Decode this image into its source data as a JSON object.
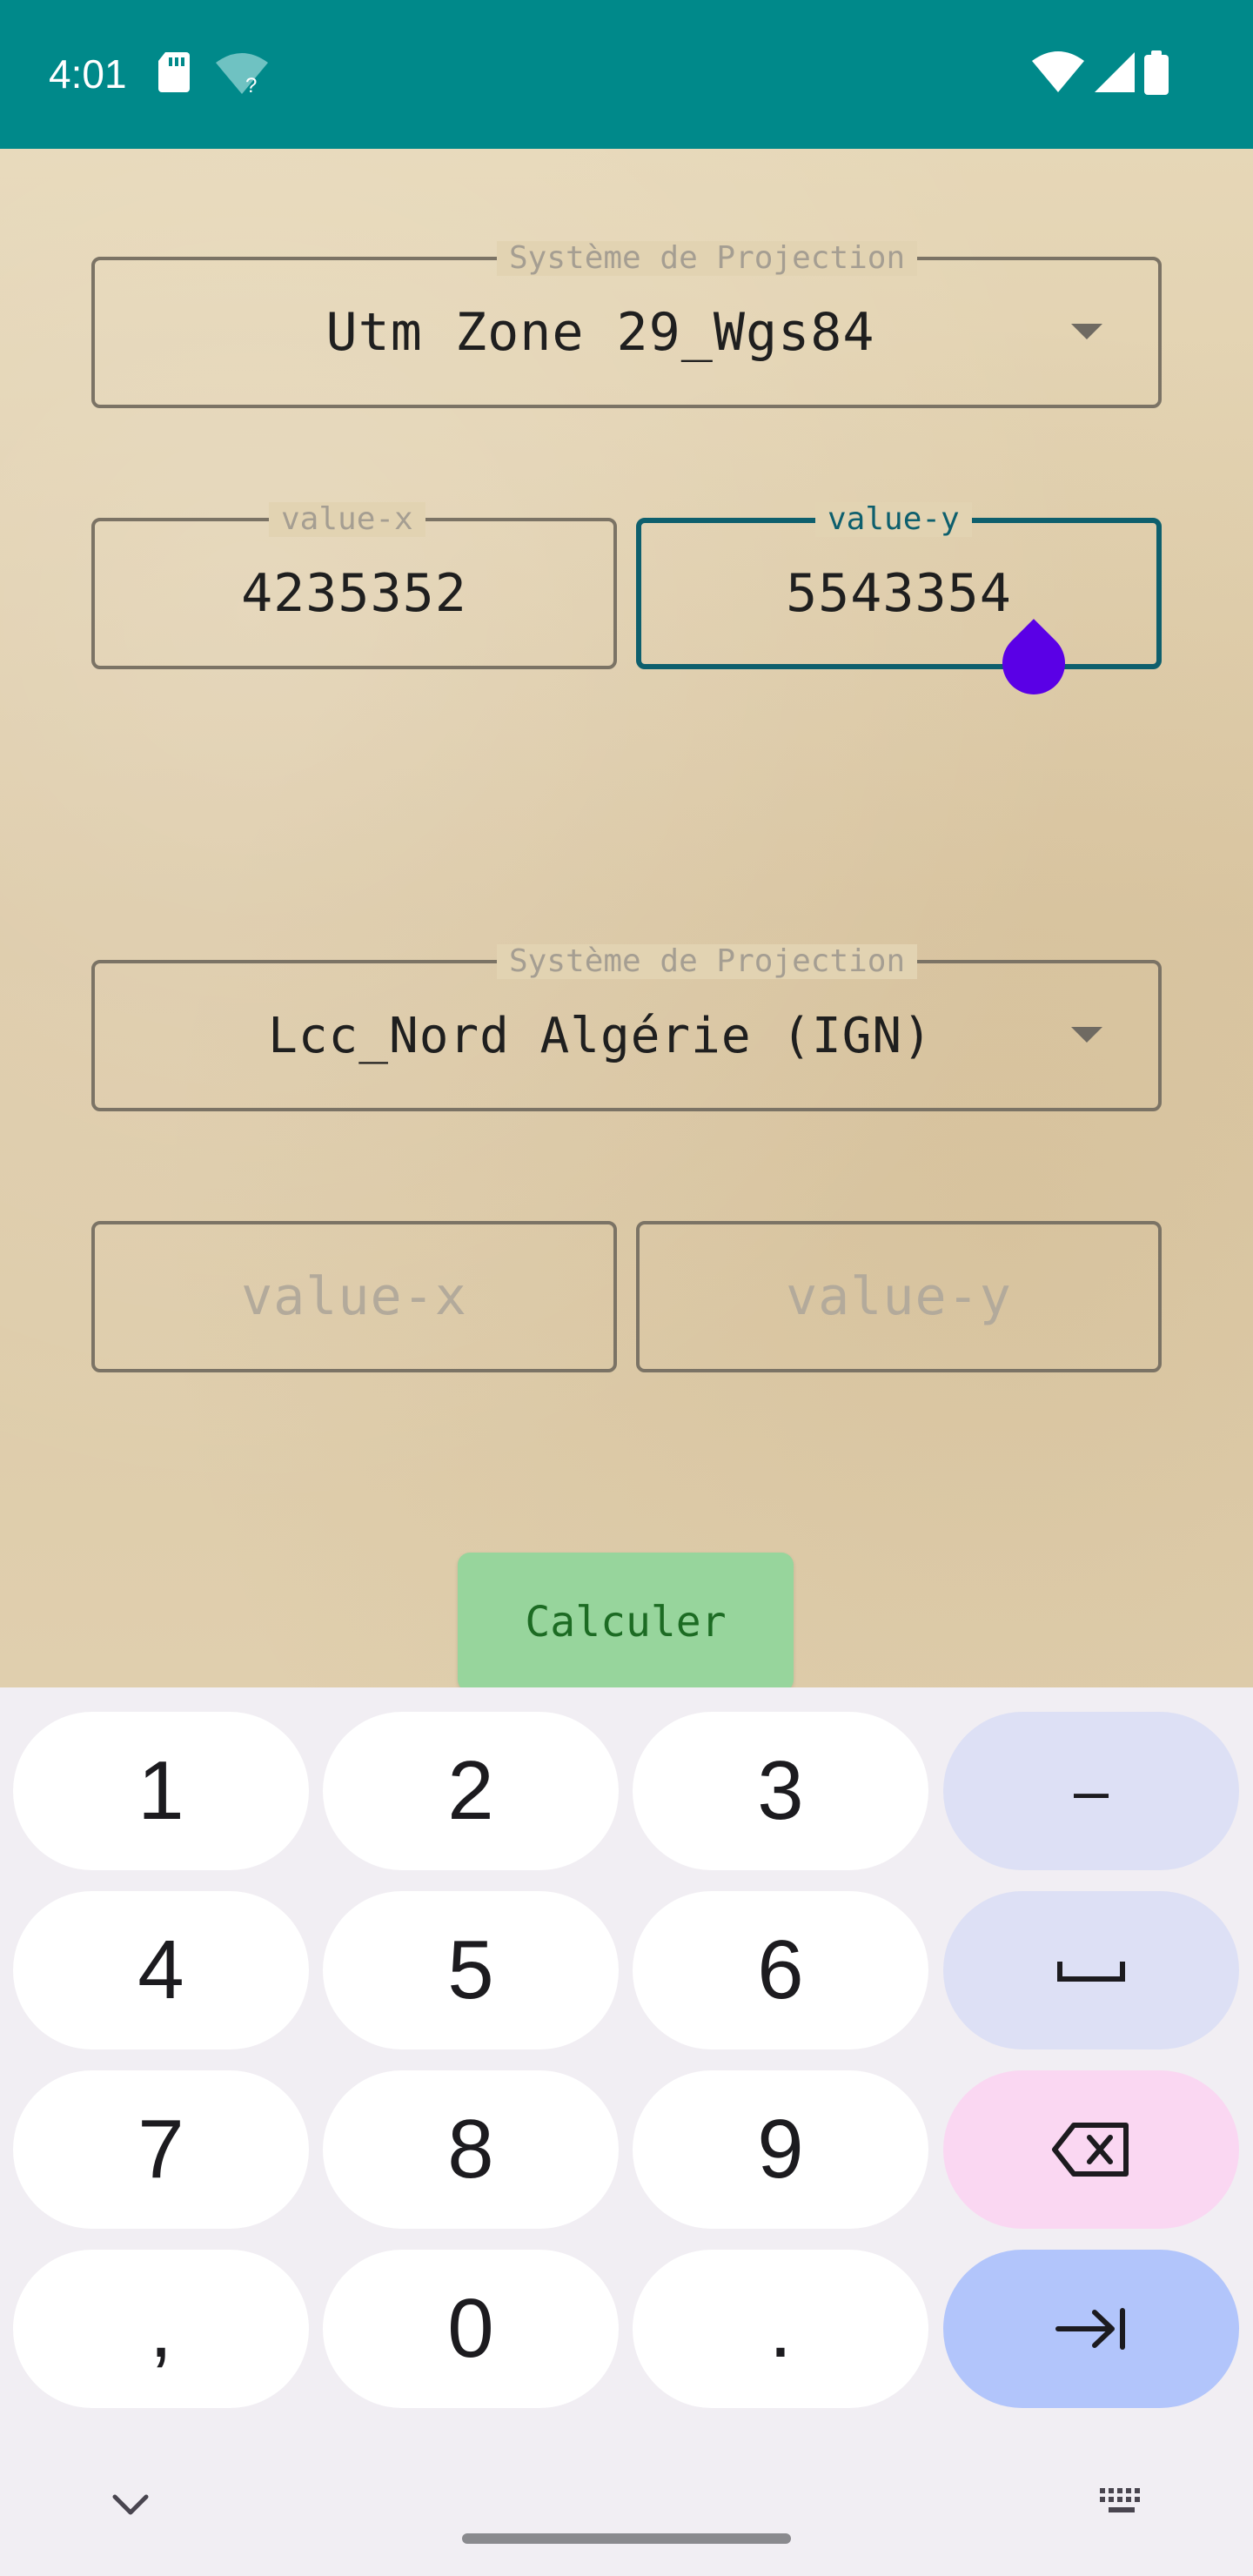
{
  "status_bar": {
    "time": "4:01",
    "icons": [
      "sd-card-icon",
      "wifi-question-icon",
      "wifi-icon",
      "signal-icon",
      "battery-icon"
    ]
  },
  "source_projection": {
    "label": "Système de Projection",
    "value": "Utm Zone 29_Wgs84"
  },
  "source_coords": {
    "x_label": "value-x",
    "x_value": "4235352",
    "y_label": "value-y",
    "y_value": "5543354"
  },
  "target_projection": {
    "label": "Système de Projection",
    "value": "Lcc_Nord Algérie (IGN)"
  },
  "target_coords": {
    "x_placeholder": "value-x",
    "y_placeholder": "value-y"
  },
  "calculate_button": "Calculer",
  "keyboard": {
    "rows": [
      [
        "1",
        "2",
        "3",
        "–"
      ],
      [
        "4",
        "5",
        "6",
        "space"
      ],
      [
        "7",
        "8",
        "9",
        "backspace"
      ],
      [
        ",",
        "0",
        ".",
        "tab"
      ]
    ],
    "labels": {
      "k1": "1",
      "k2": "2",
      "k3": "3",
      "dash": "–",
      "k4": "4",
      "k5": "5",
      "k6": "6",
      "k7": "7",
      "k8": "8",
      "k9": "9",
      "comma": ",",
      "k0": "0",
      "period": "."
    }
  },
  "colors": {
    "status_bar": "#00898a",
    "focus": "#0e5f6d",
    "cursor_handle": "#5a00e6",
    "button": "#97d59c",
    "button_text": "#1c6b23"
  }
}
